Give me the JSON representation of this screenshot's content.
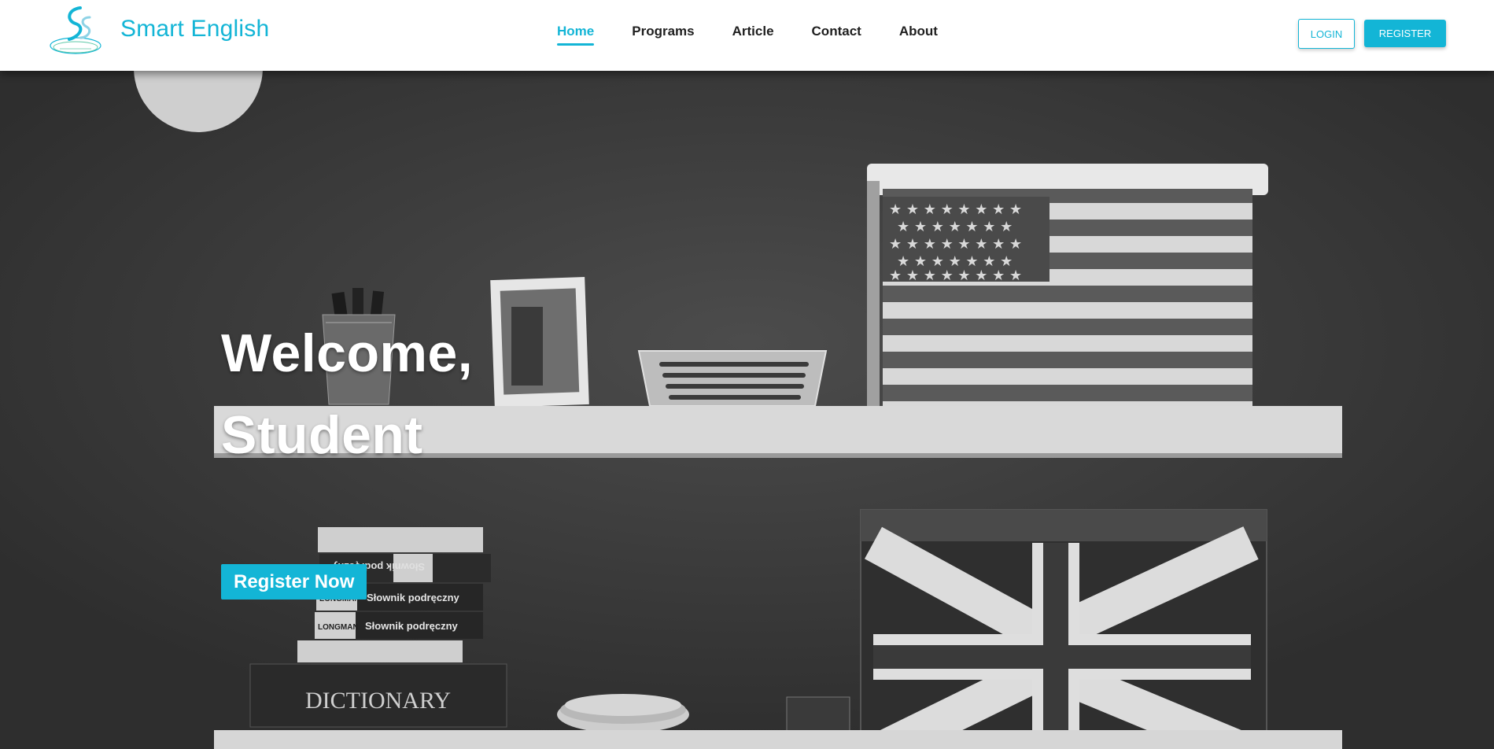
{
  "brand": {
    "name": "Smart English"
  },
  "nav": [
    {
      "label": "Home",
      "active": true
    },
    {
      "label": "Programs",
      "active": false
    },
    {
      "label": "Article",
      "active": false
    },
    {
      "label": "Contact",
      "active": false
    },
    {
      "label": "About",
      "active": false
    }
  ],
  "auth": {
    "login_label": "LOGIN",
    "register_label": "REGISTER"
  },
  "hero": {
    "title_line1": "Welcome,",
    "title_line2": "Student",
    "cta_label": "Register Now",
    "photo_text": {
      "book_spine": "Słownik podręczny",
      "book_brand": "LONGMAN",
      "dictionary": "DICTIONARY"
    }
  },
  "colors": {
    "accent": "#13b5d6",
    "nav_text": "#1e1e1e"
  }
}
